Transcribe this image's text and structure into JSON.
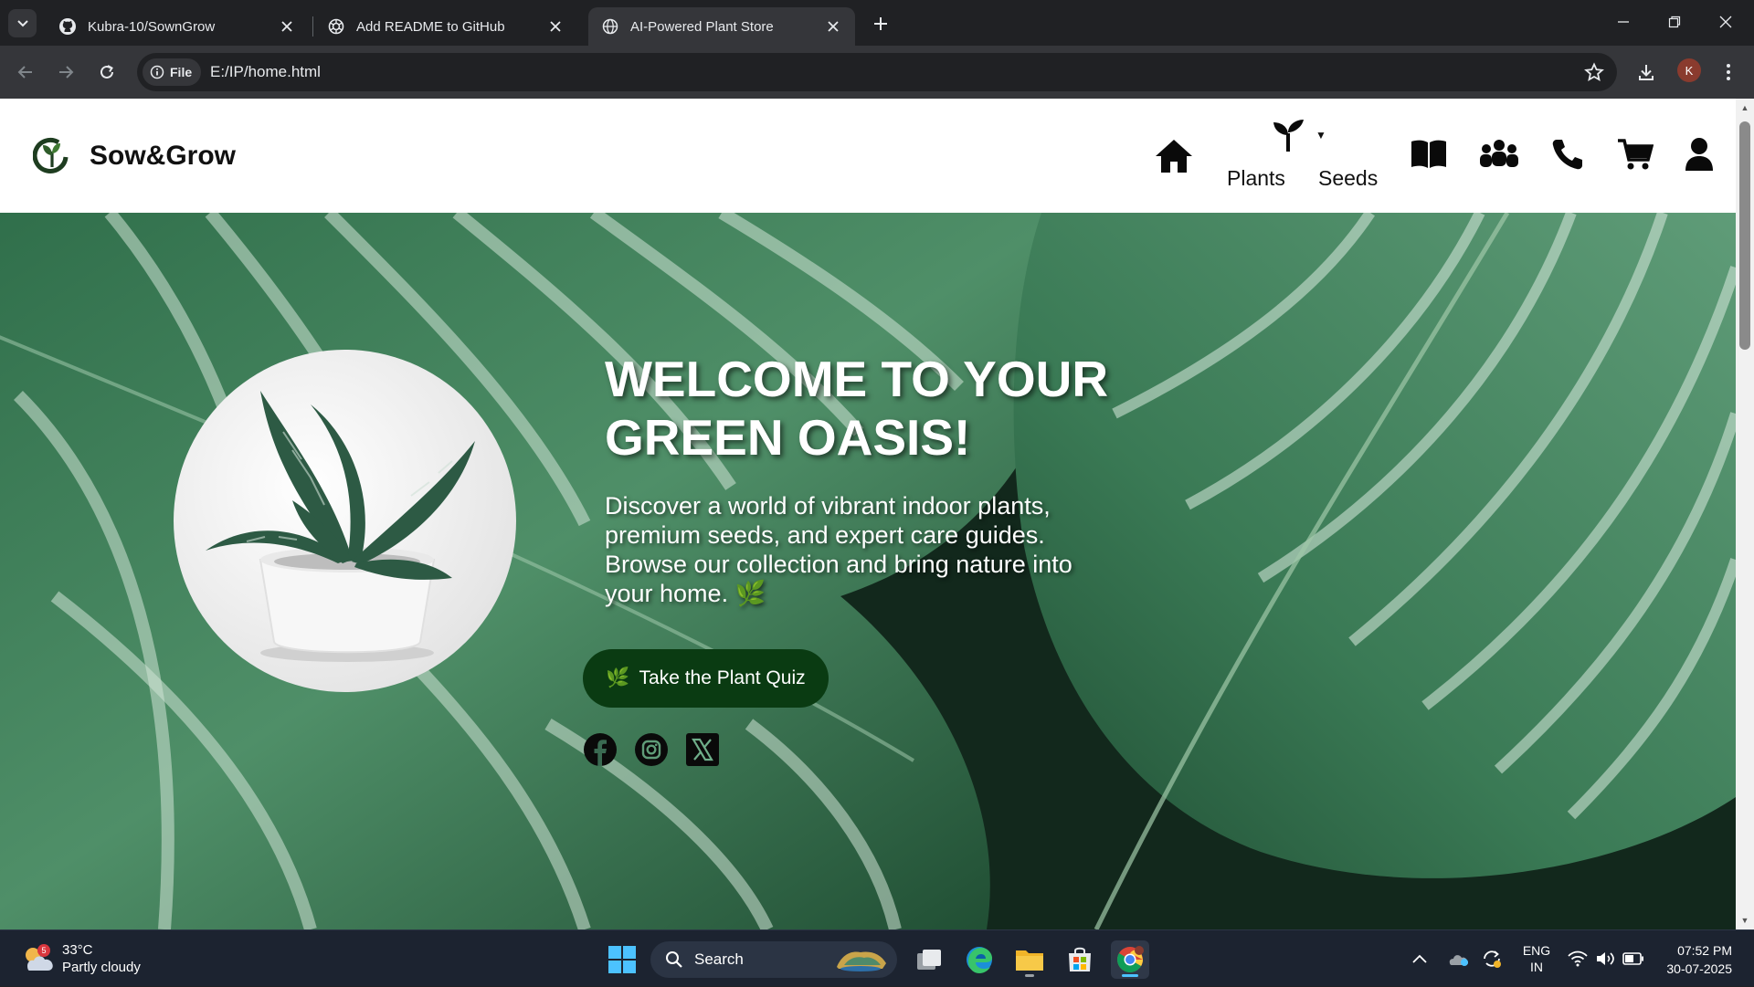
{
  "browser": {
    "tabs": [
      {
        "title": "Kubra-10/SownGrow",
        "icon": "github-icon"
      },
      {
        "title": "Add README to GitHub",
        "icon": "chatgpt-icon"
      },
      {
        "title": "AI-Powered Plant Store",
        "icon": "globe-icon",
        "active": true
      }
    ],
    "omnibox": {
      "chip_label": "File",
      "url": "E:/IP/home.html"
    },
    "profile_initial": "K"
  },
  "site": {
    "brand": "Sow&Grow",
    "nav": {
      "plants_label": "Plants",
      "seeds_label": "Seeds",
      "icons": [
        "home-icon",
        "sprout-icon",
        "book-icon",
        "community-icon",
        "phone-icon",
        "cart-icon",
        "user-icon"
      ]
    },
    "hero": {
      "title": "WELCOME TO YOUR GREEN OASIS!",
      "description": "Discover a world of vibrant indoor plants, premium seeds, and expert care guides. Browse our collection and bring nature into your home. 🌿",
      "quiz_button": "Take the Plant Quiz",
      "quiz_icon": "🌿",
      "social": [
        "facebook-icon",
        "instagram-icon",
        "x-icon"
      ]
    },
    "colors": {
      "button_bg": "#0a3b12",
      "leaf_dark": "#1e4a33",
      "leaf_light": "#cfe3d6"
    }
  },
  "taskbar": {
    "weather": {
      "temp": "33°C",
      "condition": "Partly cloudy",
      "badge": "5"
    },
    "search_label": "Search",
    "language": {
      "line1": "ENG",
      "line2": "IN"
    },
    "clock": {
      "time": "07:52 PM",
      "date": "30-07-2025"
    }
  }
}
